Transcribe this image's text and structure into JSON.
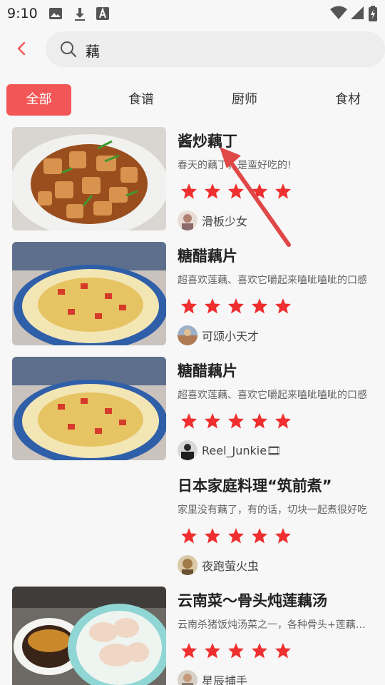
{
  "status_bar": {
    "time": "9:10",
    "icons": [
      "image-icon",
      "download-icon",
      "a-icon",
      "wifi-icon",
      "signal-icon",
      "battery-charging-icon"
    ]
  },
  "search": {
    "query": "藕"
  },
  "tabs": [
    {
      "label": "全部",
      "active": true
    },
    {
      "label": "食谱",
      "active": false
    },
    {
      "label": "厨师",
      "active": false
    },
    {
      "label": "食材",
      "active": false
    }
  ],
  "items": [
    {
      "title": "酱炒藕丁",
      "desc": "春天的藕丁，是蛮好吃的!",
      "author": "滑板少女",
      "rating": 5
    },
    {
      "title": "糖醋藕片",
      "desc": "超喜欢莲藕、喜欢它嚼起来嗑呲嗑呲的口感",
      "author": "可颂小天才",
      "rating": 5
    },
    {
      "title": "糖醋藕片",
      "desc": "超喜欢莲藕、喜欢它嚼起来嗑呲嗑呲的口感",
      "author": "Reel_Junkie🎞",
      "rating": 5
    },
    {
      "title": "日本家庭料理“筑前煮”",
      "desc": "家里没有藕了，有的话，切块一起煮很好吃",
      "author": "夜跑萤火虫",
      "rating": 5
    },
    {
      "title": "云南菜～骨头炖莲藕汤",
      "desc": "云南杀猪饭炖汤菜之一，各种骨头+莲藕炖煮",
      "author": "星辰捕手",
      "rating": 5
    }
  ],
  "colors": {
    "accent": "#f25656",
    "star": "#ef2f2f",
    "arrow": "#e04848"
  }
}
